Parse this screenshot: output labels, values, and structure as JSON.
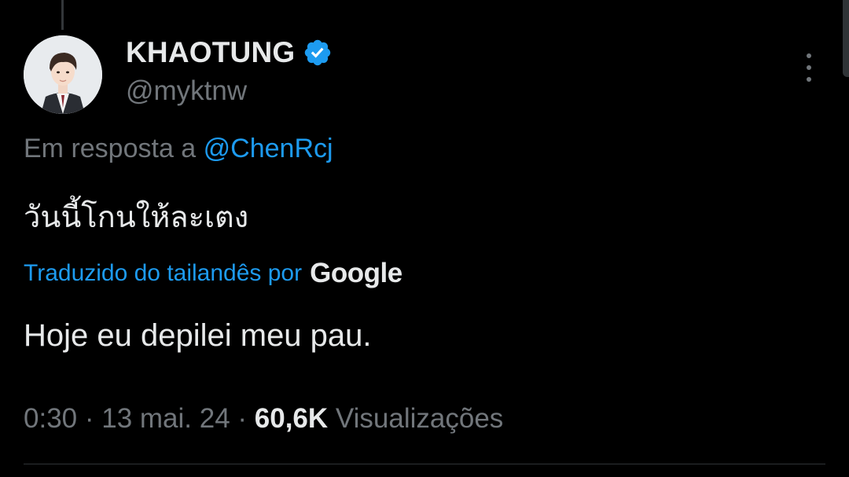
{
  "colors": {
    "background": "#000000",
    "text_primary": "#e7e9ea",
    "text_secondary": "#71767b",
    "accent": "#1d9bf0",
    "divider": "#2f3336"
  },
  "author": {
    "display_name": "KHAOTUNG",
    "handle": "@myktnw",
    "verified": true,
    "verified_icon": "verified-badge-icon",
    "avatar_icon": "avatar-photo"
  },
  "menu": {
    "more_icon": "more-vertical-icon"
  },
  "reply": {
    "prefix": "Em resposta a ",
    "mention": "@ChenRcj"
  },
  "tweet": {
    "text": "วันนี้โกนให้ละเตง"
  },
  "translation": {
    "label": "Traduzido do tailandês por",
    "provider": "Google",
    "text": "Hoje eu depilei meu pau."
  },
  "meta": {
    "time": "0:30",
    "separator": " · ",
    "date": "13 mai. 24",
    "views_count": "60,6K",
    "views_label": " Visualizações"
  }
}
